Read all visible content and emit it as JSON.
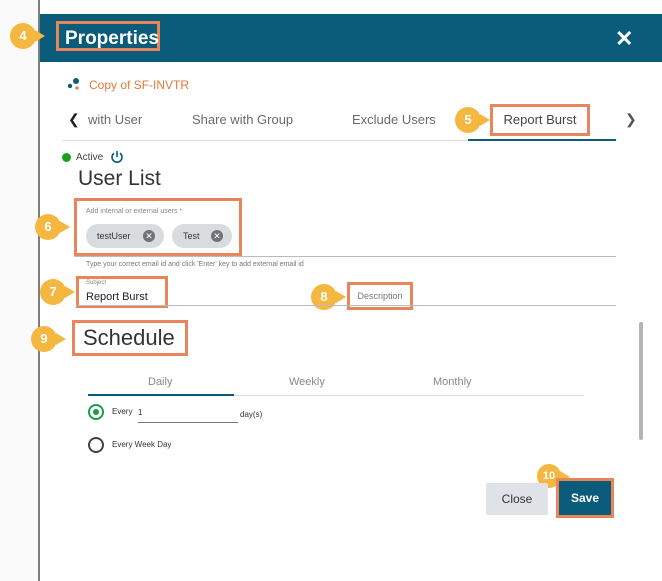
{
  "dialog": {
    "title": "Properties",
    "close_icon": "close-icon"
  },
  "datasource": {
    "name": "Copy of SF-INVTR",
    "icon": "datasource-icon"
  },
  "tabs": {
    "items": [
      {
        "label": "with User"
      },
      {
        "label": "Share with Group"
      },
      {
        "label": "Exclude Users"
      },
      {
        "label": "Report Burst"
      }
    ],
    "active": "Report Burst"
  },
  "status": {
    "label": "Active"
  },
  "user_list": {
    "title": "User List",
    "field_label": "Add internal or external users *",
    "chips": [
      {
        "label": "testUser"
      },
      {
        "label": "Test"
      }
    ],
    "hint": "Type your correct email id and click 'Enter' key to add external email id"
  },
  "subject": {
    "label": "Subject",
    "value": "Report Burst"
  },
  "description": {
    "placeholder": "Description"
  },
  "schedule": {
    "title": "Schedule",
    "tabs": [
      {
        "label": "Daily"
      },
      {
        "label": "Weekly"
      },
      {
        "label": "Monthly"
      }
    ],
    "active_tab": "Daily",
    "options": [
      {
        "label": "Every",
        "selected": true
      },
      {
        "label": "Every Week Day",
        "selected": false
      }
    ],
    "every_value": "1",
    "unit": "day(s)"
  },
  "buttons": {
    "close": "Close",
    "save": "Save"
  },
  "callouts": [
    "4",
    "5",
    "6",
    "7",
    "8",
    "9",
    "10"
  ],
  "colors": {
    "header": "#0b5b7a",
    "highlight": "#e8855a",
    "callout": "#f4b840",
    "active": "#1aa01a"
  }
}
